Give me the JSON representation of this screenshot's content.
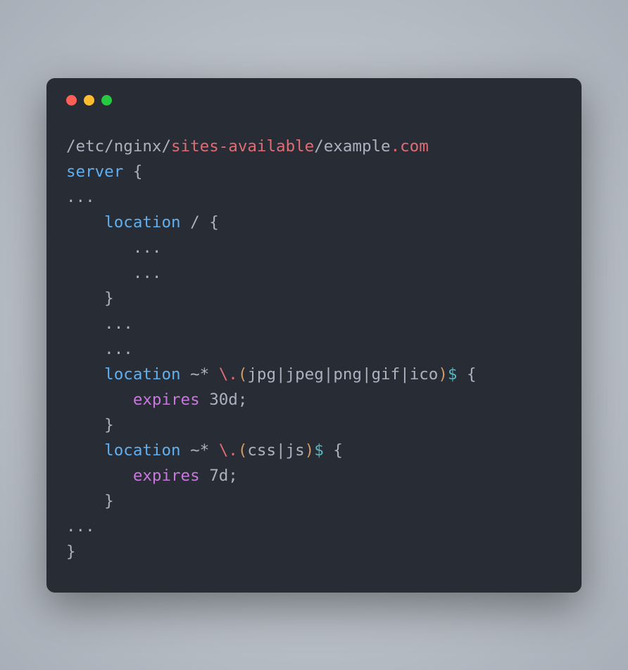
{
  "titlebar": {
    "close": "close",
    "minimize": "minimize",
    "maximize": "maximize"
  },
  "code": {
    "line1_path1": "/etc/nginx/",
    "line1_path2": "sites-available",
    "line1_path3": "/example",
    "line1_dot": ".",
    "line1_com": "com",
    "line2_server": "server",
    "line2_brace": " {",
    "line3": "...",
    "line4_loc": "    location",
    "line4_rest": " / {",
    "line5": "       ...",
    "line6": "       ...",
    "line7": "    }",
    "line8": "    ...",
    "line9": "    ...",
    "line10_loc": "    location",
    "line10_op": " ~* ",
    "line10_escape": "\\",
    "line10_dot": ".",
    "line10_paren1": "(",
    "line10_jpg": "jpg",
    "line10_pipe1": "|",
    "line10_jpeg": "jpeg",
    "line10_pipe2": "|",
    "line10_png": "png",
    "line10_pipe3": "|",
    "line10_gif": "gif",
    "line10_pipe4": "|",
    "line10_ico": "ico",
    "line10_paren2": ")",
    "line10_dollar": "$",
    "line10_brace": " {",
    "line11_expires": "       expires",
    "line11_val": " 30d",
    "line11_semi": ";",
    "line12": "    }",
    "line13_loc": "    location",
    "line13_op": " ~* ",
    "line13_escape": "\\",
    "line13_dot": ".",
    "line13_paren1": "(",
    "line13_css": "css",
    "line13_pipe1": "|",
    "line13_js": "js",
    "line13_paren2": ")",
    "line13_dollar": "$",
    "line13_brace": " {",
    "line14_expires": "       expires",
    "line14_val": " 7d",
    "line14_semi": ";",
    "line15": "    }",
    "line16": "...",
    "line17": "}"
  }
}
